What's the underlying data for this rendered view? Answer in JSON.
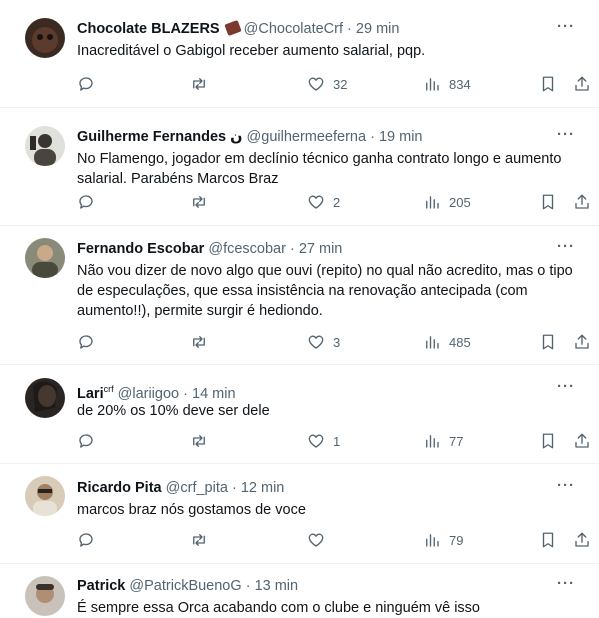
{
  "tweets": [
    {
      "name": "Chocolate BLAZERS",
      "name_suffix": "🍫",
      "handle": "@ChocolateCrf",
      "dot": "·",
      "time": "29 min",
      "text": "Inacreditável o Gabigol receber aumento salarial, pqp.",
      "reply_count": "",
      "retweet_count": "",
      "like_count": "32",
      "view_count": "834",
      "avatar_color": "#3a2a22"
    },
    {
      "name": "Guilherme Fernandes",
      "name_suffix": "ن",
      "handle": "@guilhermeeferna",
      "dot": "·",
      "time": "19 min",
      "text": "No Flamengo, jogador em declínio técnico ganha contrato longo e aumento salarial. Parabéns Marcos Braz",
      "reply_count": "",
      "retweet_count": "",
      "like_count": "2",
      "view_count": "205",
      "avatar_color": "#d9d9d5"
    },
    {
      "name": "Fernando Escobar",
      "name_suffix": "",
      "handle": "@fcescobar",
      "dot": "·",
      "time": "27 min",
      "text": "Não vou dizer de novo algo que ouvi (repito) no qual não acredito, mas o tipo de especulações, que essa insistência na renovação antecipada (com aumento!!), permite surgir é hediondo.",
      "reply_count": "",
      "retweet_count": "",
      "like_count": "3",
      "view_count": "485",
      "avatar_color": "#6b6a5a"
    },
    {
      "name": "Lari",
      "name_suffix": "crf",
      "handle": "@lariigoo",
      "dot": "·",
      "time": "14 min",
      "text": "de 20% os 10% deve ser dele",
      "reply_count": "",
      "retweet_count": "",
      "like_count": "1",
      "view_count": "77",
      "avatar_color": "#2a2522"
    },
    {
      "name": "Ricardo Pita",
      "name_suffix": "",
      "handle": "@crf_pita",
      "dot": "·",
      "time": "12 min",
      "text": "marcos braz nós gostamos de voce",
      "reply_count": "",
      "retweet_count": "",
      "like_count": "",
      "view_count": "79",
      "avatar_color": "#c9b8a4"
    },
    {
      "name": "Patrick",
      "name_suffix": "",
      "handle": "@PatrickBuenoG",
      "dot": "·",
      "time": "13 min",
      "text": "É sempre essa Orca acabando com o clube e ninguém vê isso",
      "reply_count": "",
      "retweet_count": "",
      "like_count": "",
      "view_count": "",
      "avatar_color": "#b8b2ab"
    }
  ]
}
